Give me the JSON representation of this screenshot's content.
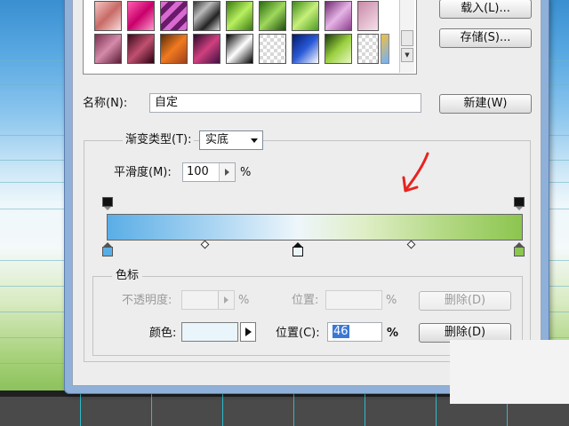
{
  "dialog": {
    "buttons": {
      "load": "载入(L)...",
      "save": "存储(S)...",
      "new": "新建(W)",
      "delete_opacity": "删除(D)",
      "delete_color": "删除(D)"
    },
    "name_label": "名称(N):",
    "name_value": "自定",
    "gradient_type_label": "渐变类型(T):",
    "gradient_type_value": "实底",
    "smoothness_label": "平滑度(M):",
    "smoothness_value": "100",
    "smoothness_unit": "%",
    "color_stops_group": "色标",
    "opacity_label": "不透明度:",
    "opacity_unit": "%",
    "location_label_disabled": "位置:",
    "location_unit_disabled": "%",
    "color_label": "颜色:",
    "location_label": "位置(C):",
    "location_value": "46",
    "location_unit": "%"
  },
  "colors": {
    "gradient_start": "#5aaee6",
    "gradient_mid": "#eef6fb",
    "gradient_end": "#8cc54f",
    "selected_stop_color": "#eaf4fb",
    "annotation_arrow": "#e8231f"
  }
}
